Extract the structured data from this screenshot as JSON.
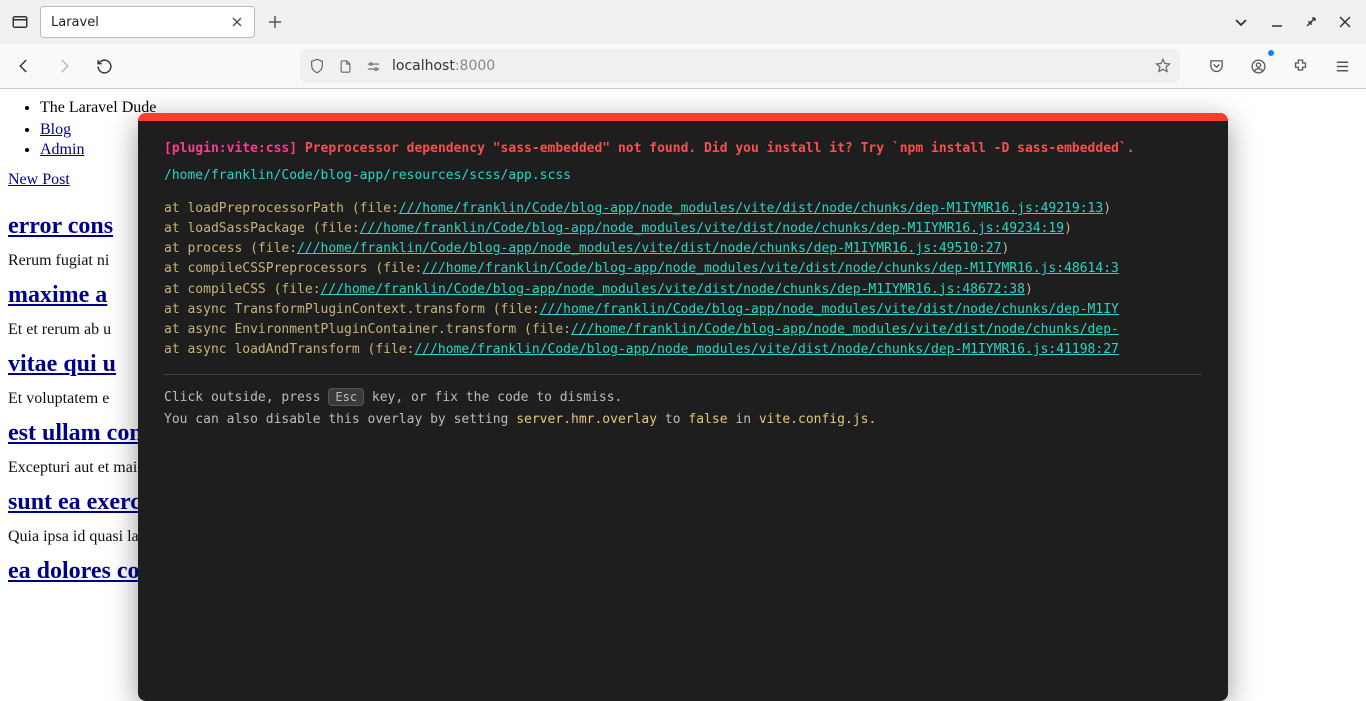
{
  "browser": {
    "tab_title": "Laravel",
    "url_host": "localhost",
    "url_port": ":8000"
  },
  "page": {
    "site_title": "The Laravel Dude",
    "nav": {
      "blog": "Blog",
      "admin": "Admin"
    },
    "new_post": "New Post",
    "posts": [
      {
        "title": "error cons",
        "excerpt": "Rerum fugiat ni"
      },
      {
        "title": "maxime a",
        "excerpt": "Et et rerum ab u"
      },
      {
        "title": "vitae qui u",
        "excerpt": "Et voluptatem e"
      },
      {
        "title": "est ullam consequatur eveniet",
        "excerpt": "Excepturi aut et maiores eos aut sint. Sequi est aliquam tempore tempore deserunt. Libero tempora cumque nihil nemo reprehenderit nisi. Assumenda vel…"
      },
      {
        "title": "sunt ea exercitationem ea",
        "excerpt": "Quia ipsa id quasi laboriosam aliquid occaecati accusantium. Voluptatem ipsum dolores rem at harum nihil consectetur. At quod enim porro quisquam volu…"
      },
      {
        "title": "ea dolores corporis maxime",
        "excerpt": ""
      }
    ]
  },
  "overlay": {
    "plugin": "[plugin:vite:css]",
    "message": "Preprocessor dependency \"sass-embedded\" not found. Did you install it? Try `npm install -D sass-embedded`.",
    "file": "/home/franklin/Code/blog-app/resources/scss/app.scss",
    "stack": [
      {
        "pre": "    at loadPreprocessorPath (file:",
        "link": "///home/franklin/Code/blog-app/node_modules/vite/dist/node/chunks/dep-M1IYMR16.js:49219:13",
        "post": ")"
      },
      {
        "pre": "    at loadSassPackage (file:",
        "link": "///home/franklin/Code/blog-app/node_modules/vite/dist/node/chunks/dep-M1IYMR16.js:49234:19",
        "post": ")"
      },
      {
        "pre": "    at process (file:",
        "link": "///home/franklin/Code/blog-app/node_modules/vite/dist/node/chunks/dep-M1IYMR16.js:49510:27",
        "post": ")"
      },
      {
        "pre": "    at compileCSSPreprocessors (file:",
        "link": "///home/franklin/Code/blog-app/node_modules/vite/dist/node/chunks/dep-M1IYMR16.js:48614:3",
        "post": ""
      },
      {
        "pre": "    at compileCSS (file:",
        "link": "///home/franklin/Code/blog-app/node_modules/vite/dist/node/chunks/dep-M1IYMR16.js:48672:38",
        "post": ")"
      },
      {
        "pre": "    at async TransformPluginContext.transform (file:",
        "link": "///home/franklin/Code/blog-app/node_modules/vite/dist/node/chunks/dep-M1IY",
        "post": ""
      },
      {
        "pre": "    at async EnvironmentPluginContainer.transform (file:",
        "link": "///home/franklin/Code/blog-app/node_modules/vite/dist/node/chunks/dep-",
        "post": ""
      },
      {
        "pre": "    at async loadAndTransform (file:",
        "link": "///home/franklin/Code/blog-app/node_modules/vite/dist/node/chunks/dep-M1IYMR16.js:41198:27",
        "post": ""
      }
    ],
    "tip1_a": "Click outside, press ",
    "tip1_esc": "Esc",
    "tip1_b": " key, or fix the code to dismiss.",
    "tip2_a": "You can also disable this overlay by setting ",
    "tip2_code1": "server.hmr.overlay",
    "tip2_b": " to ",
    "tip2_code2": "false",
    "tip2_c": " in ",
    "tip2_code3": "vite.config.js",
    "tip2_d": "."
  }
}
